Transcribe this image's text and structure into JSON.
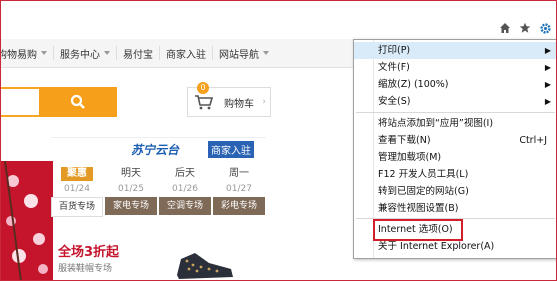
{
  "nav": {
    "items": [
      {
        "label": "购物易购",
        "has_caret": true
      },
      {
        "label": "服务中心",
        "has_caret": true
      },
      {
        "label": "易付宝",
        "has_caret": false
      },
      {
        "label": "商家入驻",
        "has_caret": false
      },
      {
        "label": "网站导航",
        "has_caret": true
      }
    ]
  },
  "cart": {
    "label": "购物车",
    "count": "0"
  },
  "suning": {
    "brand": "苏宁云台",
    "tag": "商家入驻"
  },
  "dates": [
    {
      "day": "聚惠",
      "date": "01/24",
      "tag": "百货专场"
    },
    {
      "day": "明天",
      "date": "01/25",
      "tag": "家电专场"
    },
    {
      "day": "后天",
      "date": "01/26",
      "tag": "空调专场"
    },
    {
      "day": "周一",
      "date": "01/27",
      "tag": "彩电专场"
    }
  ],
  "promo": {
    "title": "全场3折起",
    "subtitle": "服装鞋帽专场"
  },
  "menu": {
    "items": [
      {
        "label": "打印(P)",
        "has_submenu": true,
        "shortcut": ""
      },
      {
        "label": "文件(F)",
        "has_submenu": true,
        "shortcut": ""
      },
      {
        "label": "缩放(Z) (100%)",
        "has_submenu": true,
        "shortcut": ""
      },
      {
        "label": "安全(S)",
        "has_submenu": true,
        "shortcut": ""
      },
      {
        "label": "将站点添加到“应用”视图(I)",
        "has_submenu": false,
        "shortcut": ""
      },
      {
        "label": "查看下载(N)",
        "has_submenu": false,
        "shortcut": "Ctrl+J"
      },
      {
        "label": "管理加载项(M)",
        "has_submenu": false,
        "shortcut": ""
      },
      {
        "label": "F12 开发人员工具(L)",
        "has_submenu": false,
        "shortcut": ""
      },
      {
        "label": "转到已固定的网站(G)",
        "has_submenu": false,
        "shortcut": ""
      },
      {
        "label": "兼容性视图设置(B)",
        "has_submenu": false,
        "shortcut": ""
      },
      {
        "label": "Internet 选项(O)",
        "has_submenu": false,
        "shortcut": ""
      },
      {
        "label": "关于 Internet Explorer(A)",
        "has_submenu": false,
        "shortcut": ""
      }
    ],
    "highlighted_index": 0,
    "focused_index": 10
  },
  "colors": {
    "accent": "#f59f1b",
    "brand_red": "#c4152d",
    "menu_highlight": "#d9ebf9",
    "focus_border": "#d01e2a"
  }
}
